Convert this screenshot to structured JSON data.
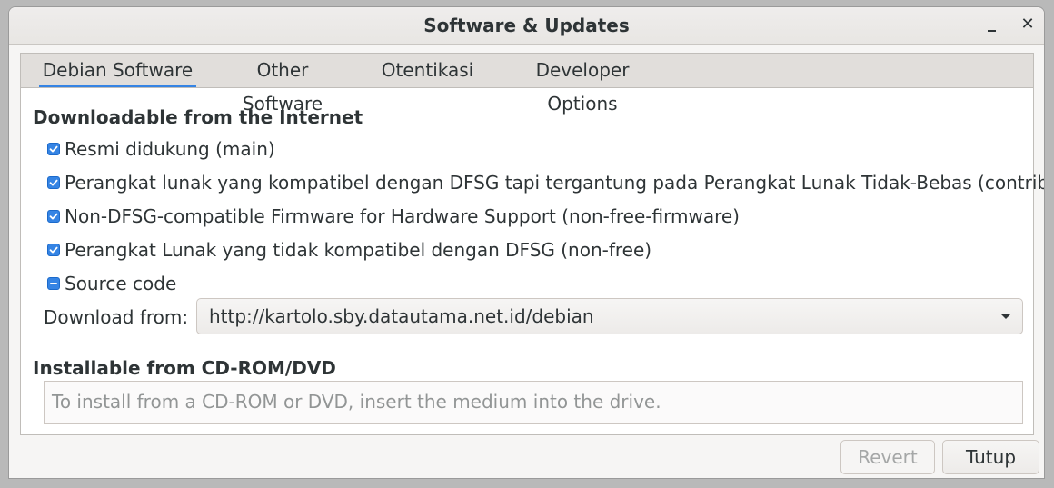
{
  "window": {
    "title": "Software & Updates"
  },
  "tabs": [
    {
      "label": "Debian Software",
      "active": true
    },
    {
      "label": "Other Software",
      "active": false
    },
    {
      "label": "Otentikasi",
      "active": false
    },
    {
      "label": "Developer Options",
      "active": false
    }
  ],
  "internet": {
    "heading": "Downloadable from the Internet",
    "items": [
      {
        "label": "Resmi didukung (main)",
        "state": "checked"
      },
      {
        "label": "Perangkat lunak yang kompatibel dengan DFSG tapi tergantung pada Perangkat Lunak Tidak-Bebas (contrib)",
        "state": "checked"
      },
      {
        "label": "Non-DFSG-compatible Firmware for Hardware Support (non-free-firmware)",
        "state": "checked"
      },
      {
        "label": "Perangkat Lunak yang tidak kompatibel dengan DFSG (non-free)",
        "state": "checked"
      },
      {
        "label": "Source code",
        "state": "indeterminate"
      }
    ],
    "download_label": "Download from:",
    "download_value": "http://kartolo.sby.datautama.net.id/debian"
  },
  "cdrom": {
    "heading": "Installable from CD-ROM/DVD",
    "message": "To install from a CD-ROM or DVD, insert the medium into the drive."
  },
  "buttons": {
    "revert": "Revert",
    "close": "Tutup"
  },
  "colors": {
    "accent": "#3584e4"
  }
}
